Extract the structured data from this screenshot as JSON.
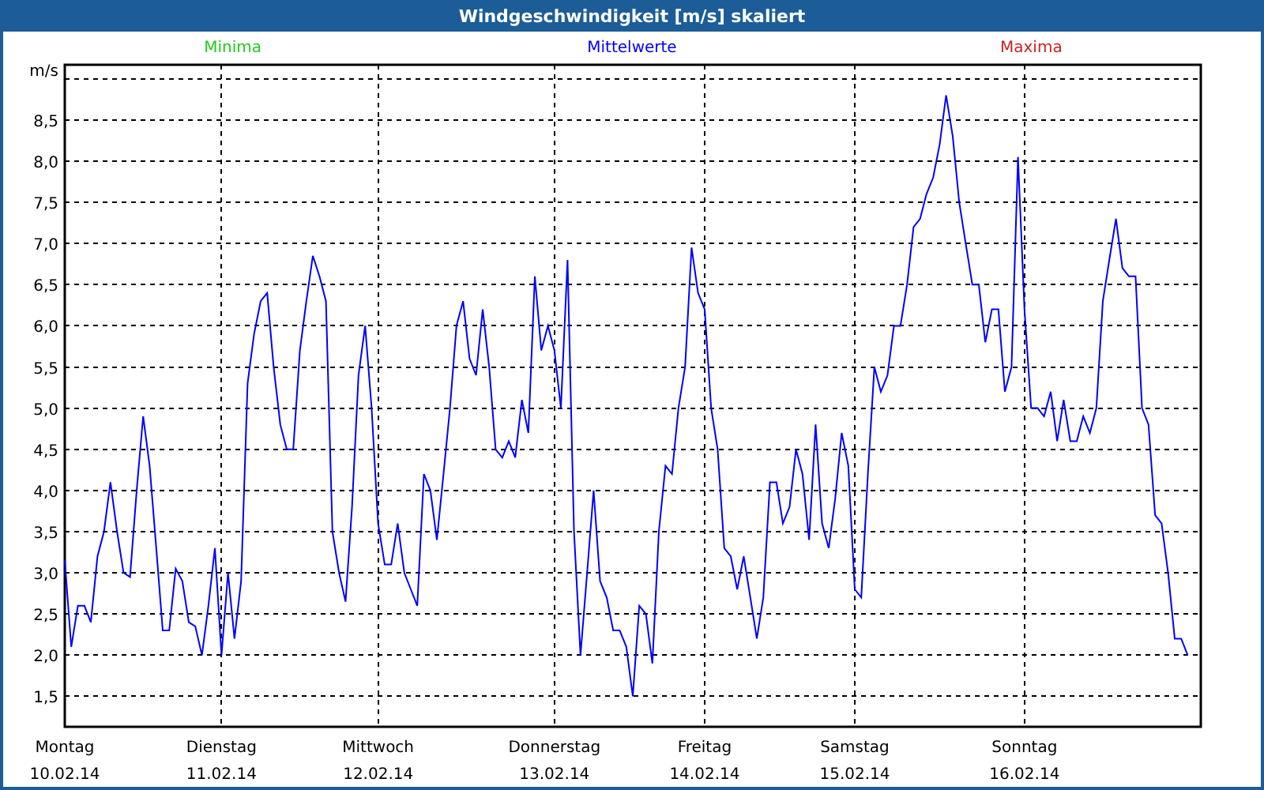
{
  "window": {
    "title": "Windgeschwindigkeit [m/s] skaliert"
  },
  "legend": [
    {
      "label": "Minima",
      "color": "#22cc22"
    },
    {
      "label": "Maxima",
      "color": "#cc2222"
    }
  ],
  "dates": [
    "10.02.14",
    "11.02.14",
    "12.02.14",
    "13.02.14",
    "14.02.14",
    "15.02.14",
    "16.02.14"
  ],
  "chart_data": {
    "type": "line",
    "grid": true,
    "ylabel": "m/s",
    "ylim": [
      1.13,
      9.17
    ],
    "categories": [
      "Montag",
      null,
      null,
      null,
      null,
      null,
      null,
      null,
      null,
      null,
      null,
      null,
      null,
      null,
      null,
      null,
      null,
      null,
      null,
      null,
      null,
      null,
      null,
      null,
      "Dienstag",
      null,
      null,
      null,
      null,
      null,
      null,
      null,
      null,
      null,
      null,
      null,
      null,
      null,
      null,
      null,
      null,
      null,
      null,
      null,
      null,
      null,
      null,
      null,
      "Mittwoch",
      null,
      null,
      null,
      null,
      null,
      null,
      null,
      null,
      null,
      null,
      null,
      null,
      null,
      null,
      null,
      null,
      null,
      null,
      null,
      null,
      null,
      null,
      null,
      null,
      null,
      null,
      "Donnerstag",
      null,
      null,
      null,
      null,
      null,
      null,
      null,
      null,
      null,
      null,
      null,
      null,
      null,
      null,
      null,
      null,
      null,
      null,
      null,
      null,
      null,
      null,
      "Freitag",
      null,
      null,
      null,
      null,
      null,
      null,
      null,
      null,
      null,
      null,
      null,
      null,
      null,
      null,
      null,
      null,
      null,
      null,
      null,
      null,
      null,
      null,
      "Samstag",
      null,
      null,
      null,
      null,
      null,
      null,
      null,
      null,
      null,
      null,
      null,
      null,
      null,
      null,
      null,
      null,
      null,
      null,
      null,
      null,
      null,
      null,
      null,
      null,
      null,
      "Sonntag",
      null,
      null,
      null,
      null,
      null,
      null,
      null,
      null,
      null,
      null,
      null,
      null,
      null,
      null,
      null,
      null,
      null,
      null,
      null,
      null,
      null,
      null,
      null,
      null,
      null
    ],
    "yticks": [
      {
        "value": 1.5,
        "label": "1,5"
      },
      {
        "value": 2,
        "label": "2,0"
      },
      {
        "value": 2.5,
        "label": "2,5"
      },
      {
        "value": 3,
        "label": "3,0"
      },
      {
        "value": 3.5,
        "label": "3,5"
      },
      {
        "value": 4,
        "label": "4,0"
      },
      {
        "value": 4.5,
        "label": "4,5"
      },
      {
        "value": 5,
        "label": "5,0"
      },
      {
        "value": 5.5,
        "label": "5,5"
      },
      {
        "value": 6,
        "label": "6,0"
      },
      {
        "value": 6.5,
        "label": "6,5"
      },
      {
        "value": 7,
        "label": "7,0"
      },
      {
        "value": 7.5,
        "label": "7,5"
      },
      {
        "value": 8,
        "label": "8,0"
      },
      {
        "value": 8.5,
        "label": "8,5"
      }
    ],
    "series": [
      {
        "name": "Mittelwerte",
        "color": "#0000ff",
        "values": [
          3.15,
          2.1,
          2.6,
          2.6,
          2.4,
          3.2,
          3.5,
          4.1,
          3.5,
          3.0,
          2.95,
          4.0,
          4.9,
          4.3,
          3.3,
          2.3,
          2.3,
          3.05,
          2.9,
          2.4,
          2.35,
          2.0,
          2.6,
          3.3,
          2.0,
          3.0,
          2.2,
          2.9,
          5.3,
          5.9,
          6.3,
          6.4,
          5.5,
          4.8,
          4.5,
          4.5,
          5.7,
          6.3,
          6.85,
          6.6,
          6.3,
          3.5,
          3.0,
          2.65,
          3.8,
          5.4,
          6.0,
          5.0,
          3.6,
          3.1,
          3.1,
          3.6,
          3.0,
          2.8,
          2.6,
          4.2,
          4.0,
          3.4,
          4.2,
          5.0,
          6.0,
          6.3,
          5.6,
          5.4,
          6.2,
          5.5,
          4.5,
          4.4,
          4.6,
          4.4,
          5.1,
          4.7,
          6.6,
          5.7,
          6.0,
          5.7,
          5.0,
          6.8,
          3.5,
          2.0,
          3.0,
          4.0,
          2.9,
          2.7,
          2.3,
          2.3,
          2.1,
          1.5,
          2.6,
          2.5,
          1.9,
          3.5,
          4.3,
          4.2,
          5.0,
          5.5,
          6.95,
          6.4,
          6.2,
          5.0,
          4.5,
          3.3,
          3.2,
          2.8,
          3.2,
          2.7,
          2.2,
          2.7,
          4.1,
          4.1,
          3.6,
          3.8,
          4.5,
          4.2,
          3.4,
          4.8,
          3.6,
          3.3,
          3.9,
          4.7,
          4.3,
          2.8,
          2.7,
          4.2,
          5.5,
          5.2,
          5.4,
          6.0,
          6.0,
          6.5,
          7.2,
          7.3,
          7.6,
          7.8,
          8.2,
          8.8,
          8.3,
          7.5,
          7.0,
          6.5,
          6.5,
          5.8,
          6.2,
          6.2,
          5.2,
          5.5,
          8.05,
          6.2,
          5.0,
          5.0,
          4.9,
          5.2,
          4.6,
          5.1,
          4.6,
          4.6,
          4.9,
          4.7,
          5.0,
          6.3,
          6.8,
          7.3,
          6.7,
          6.6,
          6.6,
          5.0,
          4.8,
          3.7,
          3.6,
          3.0,
          2.2,
          2.2,
          2.0
        ]
      }
    ]
  }
}
